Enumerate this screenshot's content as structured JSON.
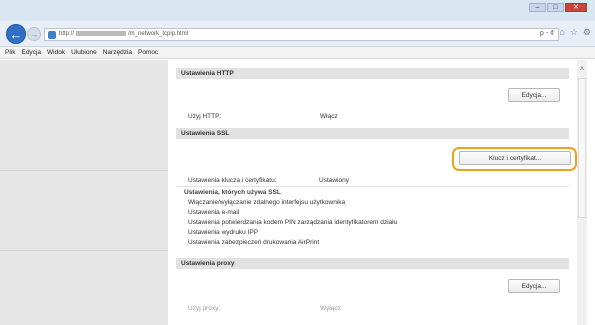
{
  "browser": {
    "url_prefix": "http://",
    "url_suffix": "/m_network_tcpip.html",
    "search_refresh": "ρ - ¢"
  },
  "window_controls": {
    "minimize": "–",
    "maximize": "□",
    "close": "✕"
  },
  "menu": {
    "items": [
      "Plik",
      "Edycja",
      "Widok",
      "Ulubione",
      "Narzędzia",
      "Pomoc"
    ]
  },
  "http_section": {
    "header": "Ustawienia HTTP",
    "edit_button": "Edycja...",
    "row_label": "Użyj HTTP:",
    "row_value": "Włącz"
  },
  "ssl_section": {
    "header": "Ustawienia SSL",
    "key_button": "Klucz i certyfikat...",
    "row_label": "Ustawienia klucza i certyfikatu:",
    "row_value": "Ustawiony",
    "subheader": "Ustawienia, których używa SSL",
    "items": [
      "Włączanie/wyłączanie zdalnego interfejsu użytkownika",
      "Ustawienia e-mail",
      "Ustawienia potwierdzania kodem PIN zarządzania identyfikatorem działu",
      "Ustawienia wydruku IPP",
      "Ustawienia zabezpieczeń drukowania AirPrint"
    ]
  },
  "proxy_section": {
    "header": "Ustawienia proxy",
    "edit_button": "Edycja...",
    "row_label": "Użyj proxy:",
    "row_value": "Wyłącz"
  },
  "colors": {
    "highlight": "#f0a020",
    "section_header_bg": "#e2e2e2",
    "left_pane_bg": "#e6e6e6"
  }
}
